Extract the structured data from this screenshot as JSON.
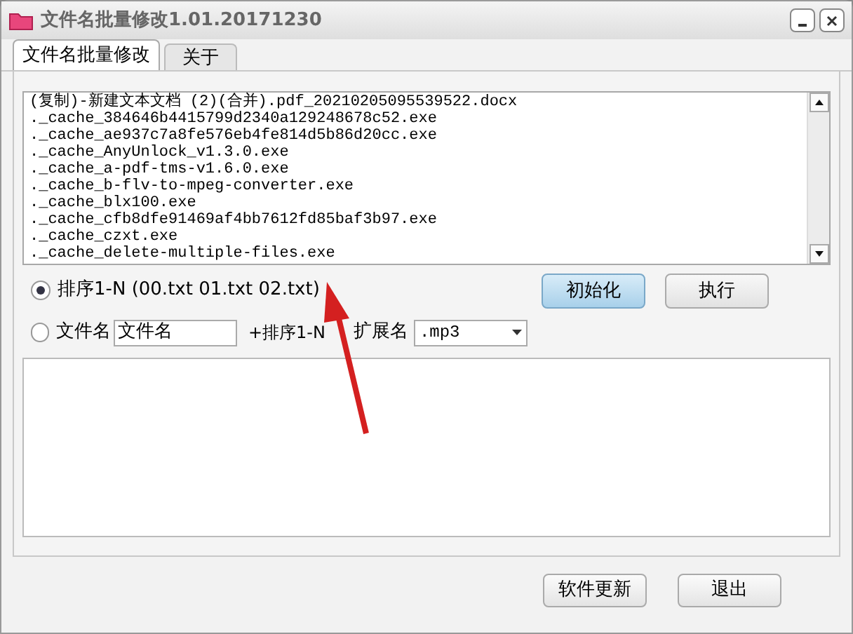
{
  "window": {
    "title": "文件名批量修改1.01.20171230"
  },
  "tabs": [
    {
      "label": "文件名批量修改",
      "selected": true
    },
    {
      "label": "关于",
      "selected": false
    }
  ],
  "file_list": [
    "(复制)-新建文本文档 (2)(合并).pdf_20210205095539522.docx",
    "._cache_384646b4415799d2340a129248678c52.exe",
    "._cache_ae937c7a8fe576eb4fe814d5b86d20cc.exe",
    "._cache_AnyUnlock_v1.3.0.exe",
    "._cache_a-pdf-tms-v1.6.0.exe",
    "._cache_b-flv-to-mpeg-converter.exe",
    "._cache_blx100.exe",
    "._cache_cfb8dfe91469af4bb7612fd85baf3b97.exe",
    "._cache_czxt.exe",
    "._cache_delete-multiple-files.exe"
  ],
  "options": [
    {
      "label": "排序1-N (00.txt  01.txt 02.txt)",
      "selected": true
    },
    {
      "label": "文件名",
      "selected": false
    }
  ],
  "name_field": {
    "value": "文件名"
  },
  "suffix_label": "+排序1-N",
  "extension": {
    "label": "扩展名",
    "value": ".mp3"
  },
  "buttons": [
    {
      "label": "初始化",
      "selected": true
    },
    {
      "label": "执行",
      "selected": false
    }
  ],
  "footer_buttons": [
    "软件更新",
    "退出"
  ]
}
